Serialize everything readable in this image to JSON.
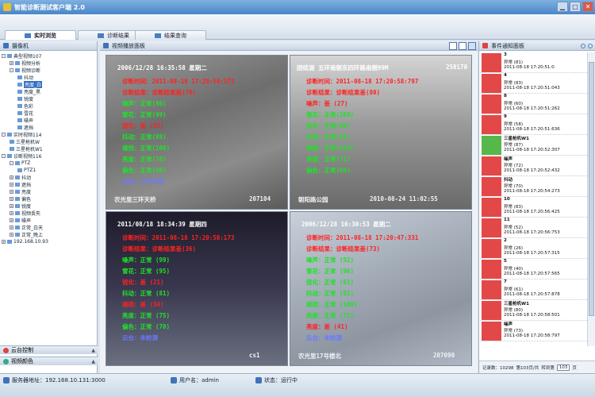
{
  "window": {
    "title": "智能诊断测试客户端 2.0"
  },
  "tabs": [
    {
      "label": "实时浏览",
      "active": true
    },
    {
      "label": "诊断结果",
      "active": false
    },
    {
      "label": "结果查询",
      "active": false
    }
  ],
  "left_panel": {
    "title": "摄像机",
    "tree": [
      {
        "label": "典型视频107",
        "level": 1,
        "toggle": "-"
      },
      {
        "label": "视频分析",
        "level": 2,
        "toggle": "+"
      },
      {
        "label": "视频诊断",
        "level": 2,
        "toggle": "-"
      },
      {
        "label": "抖动",
        "level": 3
      },
      {
        "label": "亮度_白",
        "level": 3,
        "selected": true
      },
      {
        "label": "亮度_黑",
        "level": 3
      },
      {
        "label": "锐度",
        "level": 3
      },
      {
        "label": "色彩",
        "level": 3
      },
      {
        "label": "雪花",
        "level": 3
      },
      {
        "label": "噪声",
        "level": 3
      },
      {
        "label": "遮挡",
        "level": 3
      },
      {
        "label": "实时视频114",
        "level": 1,
        "toggle": "-"
      },
      {
        "label": "三星枪机W",
        "level": 2
      },
      {
        "label": "三星枪机W1",
        "level": 2
      },
      {
        "label": "诊断视频116",
        "level": 1,
        "toggle": "-"
      },
      {
        "label": "PTZ",
        "level": 2,
        "toggle": "-"
      },
      {
        "label": "PTZ1",
        "level": 3
      },
      {
        "label": "抖动",
        "level": 2,
        "toggle": "+"
      },
      {
        "label": "遮挡",
        "level": 2,
        "toggle": "+"
      },
      {
        "label": "亮度",
        "level": 2,
        "toggle": "+"
      },
      {
        "label": "偏色",
        "level": 2,
        "toggle": "+"
      },
      {
        "label": "锐度",
        "level": 2,
        "toggle": "+"
      },
      {
        "label": "视频丢失",
        "level": 2,
        "toggle": "+"
      },
      {
        "label": "噪声",
        "level": 2,
        "toggle": "+"
      },
      {
        "label": "正常_白天",
        "level": 2,
        "toggle": "+"
      },
      {
        "label": "正常_晚上",
        "level": 2,
        "toggle": "+"
      },
      {
        "label": "192.168.10.93",
        "level": 1,
        "toggle": "+"
      }
    ],
    "bottom": [
      {
        "label": "云台控制"
      },
      {
        "label": "视频颜色"
      }
    ]
  },
  "center_panel": {
    "title": "视频播放面板",
    "videos": [
      {
        "osd_datetime": "2006/12/28  16:35:58    星期二",
        "diag_time": "诊断时间：2011-08-18 17:20:54:273",
        "diag_result": "诊断结果：诊断结果差(70)",
        "items": [
          {
            "text": "噪声：正常(86)",
            "c": "green"
          },
          {
            "text": "雪花：正常(99)",
            "c": "green"
          },
          {
            "text": "锐化：差 (35)",
            "c": "red"
          },
          {
            "text": "抖动：正常(88)",
            "c": "green"
          },
          {
            "text": "遮挡：正常(100)",
            "c": "green"
          },
          {
            "text": "亮度：正常(76)",
            "c": "green"
          },
          {
            "text": "偏色：正常(88)",
            "c": "green"
          },
          {
            "text": "云台：三环天桥",
            "c": "blue"
          }
        ],
        "osd_bottom_left": "农光里三环天桥",
        "osd_bottom_right": "207104"
      },
      {
        "osd_header": "团结湖   五环南侧东四环路南侧99M",
        "osd_corner": "250170",
        "diag_time": "诊断时间：2011-08-18 17:20:58:797",
        "diag_result": "诊断结果：诊断结果差(80)",
        "items": [
          {
            "text": "噪声：差 (27)",
            "c": "red"
          },
          {
            "text": "雪花：正常(100)",
            "c": "green"
          },
          {
            "text": "锐化：正常(80)",
            "c": "green"
          },
          {
            "text": "抖动：正常(82)",
            "c": "green"
          },
          {
            "text": "遮挡：正常(100)",
            "c": "green"
          },
          {
            "text": "亮度：正常(71)",
            "c": "green"
          },
          {
            "text": "偏色：正常(69)",
            "c": "green"
          }
        ],
        "osd_bottom_left": "朝阳路公园",
        "osd_bottom_right": "2010-08-24 11:02:55"
      },
      {
        "osd_datetime": "2011/08/18  18:34:39    星期四",
        "diag_time": "诊断时间：2011-08-18 17:20:58:173",
        "diag_result": "诊断结果：诊断结果差(36)",
        "items": [
          {
            "text": "噪声：正常 (99)",
            "c": "green"
          },
          {
            "text": "雪花：正常 (95)",
            "c": "green"
          },
          {
            "text": "锐化：差 (21)",
            "c": "red"
          },
          {
            "text": "抖动：正常 (81)",
            "c": "green"
          },
          {
            "text": "遮挡：差 (34)",
            "c": "red"
          },
          {
            "text": "亮度：正常 (75)",
            "c": "green"
          },
          {
            "text": "偏色：正常 (70)",
            "c": "green"
          },
          {
            "text": "云台：未检测",
            "c": "blue"
          }
        ],
        "osd_bottom_left": "",
        "osd_bottom_right": "cs1"
      },
      {
        "osd_datetime": "2006/12/28  16:30:53    星期二",
        "diag_time": "诊断时间：2011-08-18 17:20:47:331",
        "diag_result": "诊断结果：诊断结果差(73)",
        "items": [
          {
            "text": "噪声：正常 (92)",
            "c": "green"
          },
          {
            "text": "雪花：正常 (96)",
            "c": "green"
          },
          {
            "text": "锐化：正常 (61)",
            "c": "green"
          },
          {
            "text": "抖动：正常 (81)",
            "c": "green"
          },
          {
            "text": "遮挡：正常 (100)",
            "c": "green"
          },
          {
            "text": "亮度：正常 (72)",
            "c": "green"
          },
          {
            "text": "亮度：差 (41)",
            "c": "red"
          },
          {
            "text": "云台：未检测",
            "c": "blue"
          }
        ],
        "osd_bottom_left": "农光里17号楼北",
        "osd_bottom_right": "207090"
      }
    ]
  },
  "right_panel": {
    "title": "事件通知面板",
    "events": [
      {
        "l1": "3",
        "l2": "异常 (81)",
        "l3": "2011-08-18 17:20:51:0",
        "c": "red"
      },
      {
        "l1": "4",
        "l2": "异常 (83)",
        "l3": "2011-08-18 17:20:51:043",
        "c": "red"
      },
      {
        "l1": "8",
        "l2": "异常 (60)",
        "l3": "2011-08-18 17:20:51:262",
        "c": "red"
      },
      {
        "l1": "9",
        "l2": "异常 (58)",
        "l3": "2011-08-18 17:20:51:636",
        "c": "red"
      },
      {
        "l1": "三星枪机W1",
        "l2": "异常 (87)",
        "l3": "2011-08-18 17:20:52:307",
        "c": "green"
      },
      {
        "l1": "噪声",
        "l2": "异常 (72)",
        "l3": "2011-08-18 17:20:52:432",
        "c": "red"
      },
      {
        "l1": "抖动",
        "l2": "异常 (70)",
        "l3": "2011-08-18 17:20:54:273",
        "c": "red"
      },
      {
        "l1": "10",
        "l2": "异常 (83)",
        "l3": "2011-08-18 17:20:56:425",
        "c": "red"
      },
      {
        "l1": "11",
        "l2": "异常 (52)",
        "l3": "2011-08-18 17:20:56:753",
        "c": "red"
      },
      {
        "l1": "2",
        "l2": "异常 (26)",
        "l3": "2011-08-18 17:20:57:315",
        "c": "red"
      },
      {
        "l1": "5",
        "l2": "异常 (40)",
        "l3": "2011-08-18 17:20:57:565",
        "c": "red"
      },
      {
        "l1": "7",
        "l2": "异常 (61)",
        "l3": "2011-08-18 17:20:57:878",
        "c": "red"
      },
      {
        "l1": "三星枪机W1",
        "l2": "异常 (80)",
        "l3": "2011-08-18 17:20:58:501",
        "c": "red"
      },
      {
        "l1": "噪声",
        "l2": "异常 (73)",
        "l3": "2011-08-18 17:20:58:797",
        "c": "red"
      }
    ],
    "footer": {
      "count_label": "记录数：10298",
      "page_label": "第103页/共",
      "goto_label": "转到第",
      "goto_value": "103",
      "page_suffix": "页"
    }
  },
  "statusbar": {
    "server": "服务器地址：192.168.10.131:3000",
    "user": "用户名：admin",
    "status": "状态：运行中"
  }
}
